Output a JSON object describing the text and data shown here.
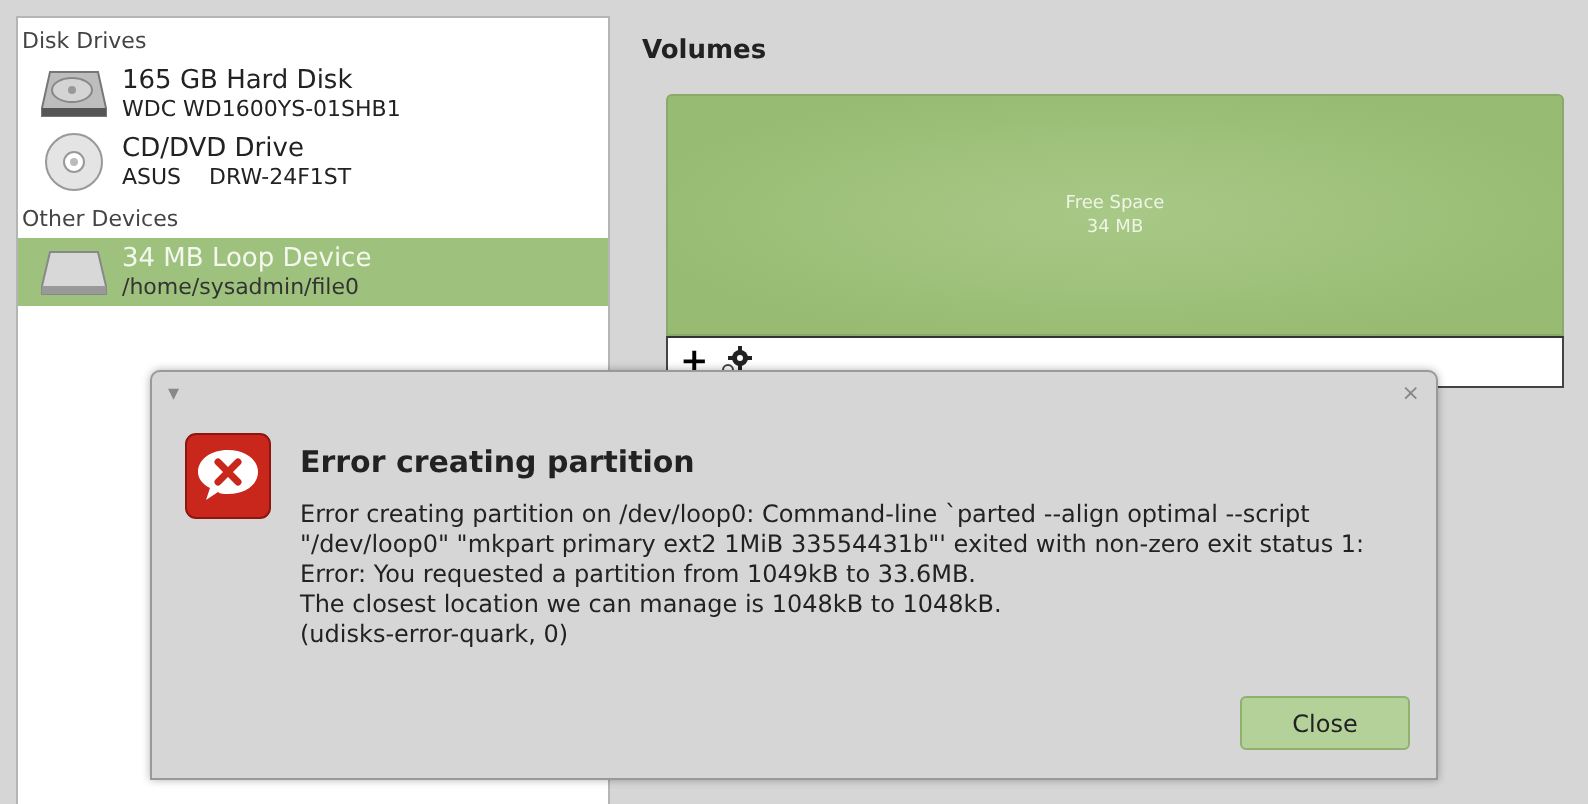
{
  "sidebar": {
    "sections": [
      {
        "heading": "Disk Drives",
        "items": [
          {
            "name": "165 GB Hard Disk",
            "detail": "WDC WD1600YS-01SHB1",
            "kind": "hdd",
            "selected": false
          },
          {
            "name": "CD/DVD Drive",
            "detail": "ASUS    DRW-24F1ST",
            "kind": "optical",
            "selected": false
          }
        ]
      },
      {
        "heading": "Other Devices",
        "items": [
          {
            "name": "34 MB Loop Device",
            "detail": "/home/sysadmin/file0",
            "kind": "loop",
            "selected": true
          }
        ]
      }
    ]
  },
  "volumes": {
    "title": "Volumes",
    "segments": [
      {
        "label": "Free Space",
        "size": "34 MB"
      }
    ],
    "toolbar": [
      {
        "kind": "add",
        "label": "+"
      },
      {
        "kind": "settings"
      }
    ]
  },
  "dialog": {
    "menu": "▾",
    "close_icon": "×",
    "title": "Error creating partition",
    "message": "Error creating partition on /dev/loop0: Command-line `parted --align optimal --script \"/dev/loop0\" \"mkpart primary ext2 1MiB 33554431b\"' exited with non-zero exit status 1: Error: You requested a partition from 1049kB to 33.6MB.\nThe closest location we can manage is 1048kB to 1048kB.\n (udisks-error-quark, 0)",
    "buttons": [
      "Close"
    ]
  }
}
